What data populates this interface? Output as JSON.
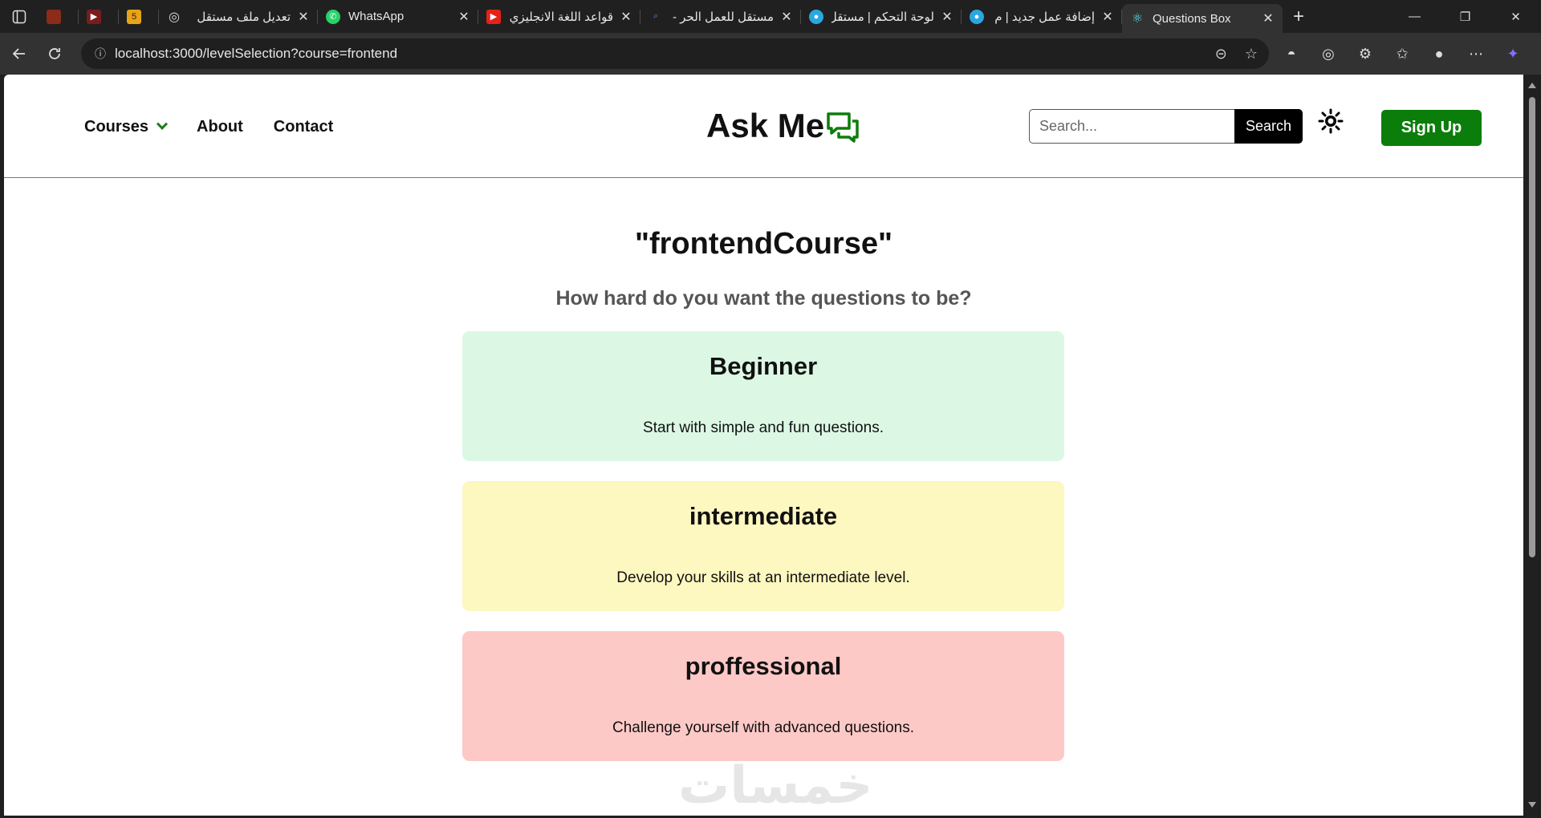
{
  "browser": {
    "tabs": [
      {
        "label": "",
        "favicon_color": "#8b2b1a",
        "favicon_glyph": ""
      },
      {
        "label": "",
        "favicon_color": "#7a1c1c",
        "favicon_glyph": "▶"
      },
      {
        "label": "",
        "favicon_color": "#e8a317",
        "favicon_glyph": "5"
      },
      {
        "label": "تعديل ملف مستقل",
        "favicon_color": "#444444",
        "favicon_glyph": "◎"
      },
      {
        "label": "WhatsApp",
        "favicon_color": "#25d366",
        "favicon_glyph": "✆"
      },
      {
        "label": "قواعد اللغة الانجليزي",
        "favicon_color": "#e62117",
        "favicon_glyph": "▶"
      },
      {
        "label": "مستقل للعمل الحر -",
        "favicon_color": "#1e6fd9",
        "favicon_glyph": "⌕"
      },
      {
        "label": "لوحة التحكم | مستقل",
        "favicon_color": "#2aa7e0",
        "favicon_glyph": "●"
      },
      {
        "label": "إضافة عمل جديد | م",
        "favicon_color": "#2aa7e0",
        "favicon_glyph": "●"
      },
      {
        "label": "Questions Box",
        "favicon_color": "#61dafb",
        "favicon_glyph": "⚛"
      }
    ],
    "url": "localhost:3000/levelSelection?course=frontend"
  },
  "header": {
    "nav": {
      "courses": "Courses",
      "about": "About",
      "contact": "Contact"
    },
    "logo_text": "Ask Me",
    "search": {
      "placeholder": "Search...",
      "button": "Search"
    },
    "signup": "Sign Up",
    "brand_color": "#0b7d0b"
  },
  "main": {
    "course_title": "\"frontendCourse\"",
    "question": "How hard do you want the questions to be?",
    "levels": [
      {
        "title": "Beginner",
        "description": "Start with simple and fun questions.",
        "color": "#dcf8e5"
      },
      {
        "title": "intermediate",
        "description": "Develop your skills at an intermediate level.",
        "color": "#fdf7c0"
      },
      {
        "title": "proffessional",
        "description": "Challenge yourself with advanced questions.",
        "color": "#fdc9c7"
      }
    ]
  },
  "watermark": "خمسات"
}
